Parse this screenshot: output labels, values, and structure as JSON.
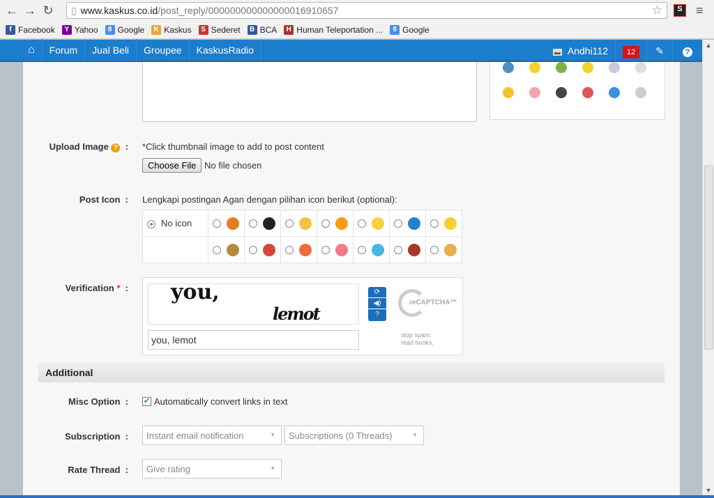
{
  "browser": {
    "url_host": "www.kaskus.co.id",
    "url_path": "/post_reply/000000000000000016910657",
    "extension_label": "S"
  },
  "bookmarks": [
    {
      "label": "Facebook",
      "color": "#3b5998",
      "glyph": "f"
    },
    {
      "label": "Yahoo",
      "color": "#7b0099",
      "glyph": "Y"
    },
    {
      "label": "Google",
      "color": "#4a8af4",
      "glyph": "8"
    },
    {
      "label": "Kaskus",
      "color": "#e8a33c",
      "glyph": "K"
    },
    {
      "label": "Sederet",
      "color": "#c0392b",
      "glyph": "S"
    },
    {
      "label": "BCA",
      "color": "#2c5aa0",
      "glyph": "B"
    },
    {
      "label": "Human Teleportation ...",
      "color": "#a33",
      "glyph": "H"
    },
    {
      "label": "Google",
      "color": "#4a8af4",
      "glyph": "8"
    }
  ],
  "nav": {
    "items": [
      "Forum",
      "Jual Beli",
      "Groupee",
      "KaskusRadio"
    ],
    "username": "Andhi112",
    "notifications": "12"
  },
  "form": {
    "upload_label": "Upload Image",
    "upload_hint": "*Click thumbnail image to add to post content",
    "choose_file": "Choose File",
    "no_file": "No file chosen",
    "post_icon_label": "Post Icon",
    "post_icon_hint": "Lengkapi postingan Agan dengan pilihan icon berikut (optional):",
    "no_icon": "No icon",
    "icons_row1": [
      {
        "name": "pencil",
        "color": "#e67e22"
      },
      {
        "name": "clapperboard",
        "color": "#222"
      },
      {
        "name": "lightbulb",
        "color": "#f5c342"
      },
      {
        "name": "warning",
        "color": "#f39c12"
      },
      {
        "name": "star",
        "color": "#f7d23e"
      },
      {
        "name": "cool",
        "color": "#2a7fc1"
      },
      {
        "name": "smile",
        "color": "#f2d22e"
      }
    ],
    "icons_row2": [
      {
        "name": "poop",
        "color": "#b5883a"
      },
      {
        "name": "grin-red",
        "color": "#d9453a"
      },
      {
        "name": "laugh",
        "color": "#f06a3b"
      },
      {
        "name": "heart",
        "color": "#f07a8a"
      },
      {
        "name": "blue-smile",
        "color": "#49b6e0"
      },
      {
        "name": "burst",
        "color": "#a8372c"
      },
      {
        "name": "thumbs-up",
        "color": "#e8b04a"
      }
    ],
    "verification_label": "Verification",
    "captcha_word1": "you,",
    "captcha_word2": "lemot",
    "captcha_value": "you, lemot",
    "recaptcha_logo": "reCAPTCHA™",
    "recaptcha_tagline1": "stop spam.",
    "recaptcha_tagline2": "read books.",
    "additional_title": "Additional",
    "misc_label": "Misc Option",
    "misc_checkbox": "Automatically convert links in text",
    "misc_checked": true,
    "subscription_label": "Subscription",
    "subscription_value": "Instant email notification",
    "subscription_folder": "Subscriptions (0 Threads)",
    "rate_label": "Rate Thread",
    "rate_value": "Give rating"
  },
  "smilies_colors": [
    "#4a90c2",
    "#f2d22e",
    "#7cb342",
    "#f2d22e",
    "#c8c8e0",
    "#ddd",
    "#f2c22e",
    "#f4a6b0",
    "#444",
    "#e05555",
    "#3f8fe0",
    "#ccc"
  ]
}
